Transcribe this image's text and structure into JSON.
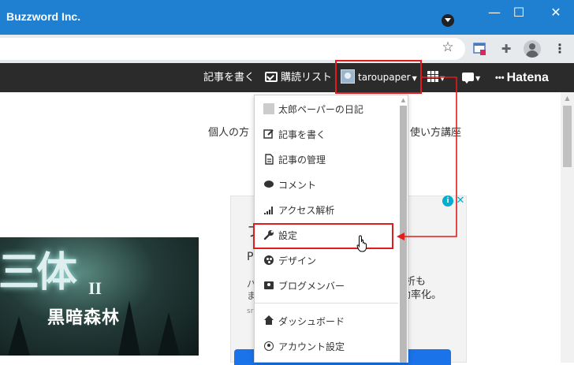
{
  "window": {
    "title": "Buzzword Inc.",
    "minimize": "—",
    "maximize": "☐",
    "close": "✕"
  },
  "browser": {
    "star_icon": "☆",
    "puzzle_icon": "✚",
    "menu_icon": "⋮"
  },
  "hatena_header": {
    "write_label": "記事を書く",
    "readlist_label": "購読リスト",
    "username": "taroupaper",
    "caret": "▼",
    "logo_mark": "•••",
    "logo_text": "Hatena"
  },
  "page": {
    "left_text": "個人の方",
    "right_text": "使い方講座"
  },
  "ad": {
    "info": "i",
    "close": "✕",
    "partial_title": "フ",
    "partial_p": "P",
    "partial_b": "パ",
    "partial_m": "ま",
    "partial_sm": "sr",
    "text_1": "析も",
    "text_2": "効率化。"
  },
  "book": {
    "big_title": "三体",
    "roman": "II",
    "subtitle": "黒暗森林"
  },
  "dropdown": {
    "items": [
      {
        "label": "太郎ペーパーの日記"
      },
      {
        "label": "記事を書く"
      },
      {
        "label": "記事の管理"
      },
      {
        "label": "コメント"
      },
      {
        "label": "アクセス解析"
      },
      {
        "label": "設定"
      },
      {
        "label": "デザイン"
      },
      {
        "label": "ブログメンバー"
      },
      {
        "label": "ダッシュボード"
      },
      {
        "label": "アカウント設定"
      }
    ],
    "wrench_glyph": "🔧"
  },
  "colors": {
    "titlebar": "#1f7fd1",
    "hatena_bar": "#2b2b2b",
    "annotation_red": "#e31b1b",
    "ad_accent": "#00aecd"
  }
}
